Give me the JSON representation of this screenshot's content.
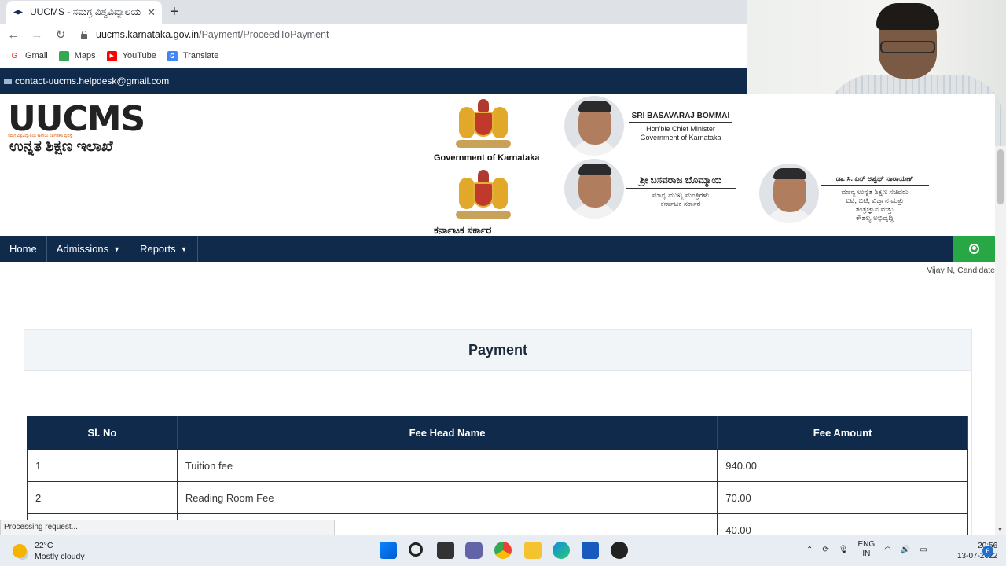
{
  "browser": {
    "tab_title": "UUCMS - ಸಮಗ್ರ ವಿಶ್ವವಿದ್ಯಾಲಯ",
    "url_host": "uucms.karnataka.gov.in",
    "url_path": "/Payment/ProceedToPayment",
    "bookmarks": [
      {
        "label": "Gmail",
        "icon": "gmail-icon",
        "color": "#ea4335"
      },
      {
        "label": "Maps",
        "icon": "maps-icon",
        "color": "#34a853"
      },
      {
        "label": "YouTube",
        "icon": "youtube-icon",
        "color": "#ff0000"
      },
      {
        "label": "Translate",
        "icon": "translate-icon",
        "color": "#4285f4"
      }
    ],
    "status_text": "Processing request..."
  },
  "site": {
    "contact_email": "contact-uucms.helpdesk@gmail.com",
    "logo_text": "UUCMS",
    "logo_subtitle": "ಸಮಗ್ರ ವಿಶ್ವವಿದ್ಯಾಲಯ ಕಾಲೇಜು ನಿರ್ವಹಣಾ ವ್ಯವಸ್ಥೆ",
    "logo_kannada": "ಉನ್ನತ ಶಿಕ್ಷಣ ಇಲಾಖೆ",
    "emblem_caption_en": "Government of Karnataka",
    "emblem_caption_kn": "ಕರ್ನಾಟಕ ಸರ್ಕಾರ",
    "cm_en": {
      "name": "SRI BASAVARAJ BOMMAI",
      "line1": "Hon'ble Chief Minister",
      "line2": "Government of Karnataka"
    },
    "cm_kn": {
      "name": "ಶ್ರೀ ಬಸವರಾಜ ಬೊಮ್ಮಾಯಿ",
      "line1": "ಮಾನ್ಯ ಮುಖ್ಯ ಮಂತ್ರಿಗಳು",
      "line2": "ಕರ್ನಾಟಕ ಸರ್ಕಾರ"
    },
    "minister_kn": {
      "name": "ಡಾ. ಸಿ. ಎನ್ ಅಶ್ವಥ್ ನಾರಾಯಣ್",
      "line1": "ಮಾನ್ಯ ಉನ್ನತ ಶಿಕ್ಷಣ ಸಚಿವರು",
      "line2": "ಐಟಿ, ಬಿಟಿ, ವಿಜ್ಞಾನ ಮತ್ತು",
      "line3": "ತಂತ್ರಜ್ಞಾನ ಮತ್ತು",
      "line4": "ಕೌಶಲ್ಯ ಅಭಿವೃದ್ಧಿ"
    },
    "nav": {
      "home": "Home",
      "admissions": "Admissions",
      "reports": "Reports"
    },
    "user_name": "Vijay N, Candidate"
  },
  "payment": {
    "title": "Payment",
    "columns": [
      "Sl. No",
      "Fee Head Name",
      "Fee Amount"
    ],
    "rows": [
      {
        "sl": "1",
        "name": "Tuition fee",
        "amount": "940.00"
      },
      {
        "sl": "2",
        "name": "Reading Room Fee",
        "amount": "70.00"
      },
      {
        "sl": "",
        "name": "",
        "amount": "40.00"
      }
    ]
  },
  "taskbar": {
    "temperature": "22°C",
    "weather": "Mostly cloudy",
    "lang1": "ENG",
    "lang2": "IN",
    "time": "20:56",
    "date": "13-07-2022",
    "notifications": "6"
  },
  "colors": {
    "nav_bg": "#0f2a4a",
    "user_button": "#28a745"
  }
}
